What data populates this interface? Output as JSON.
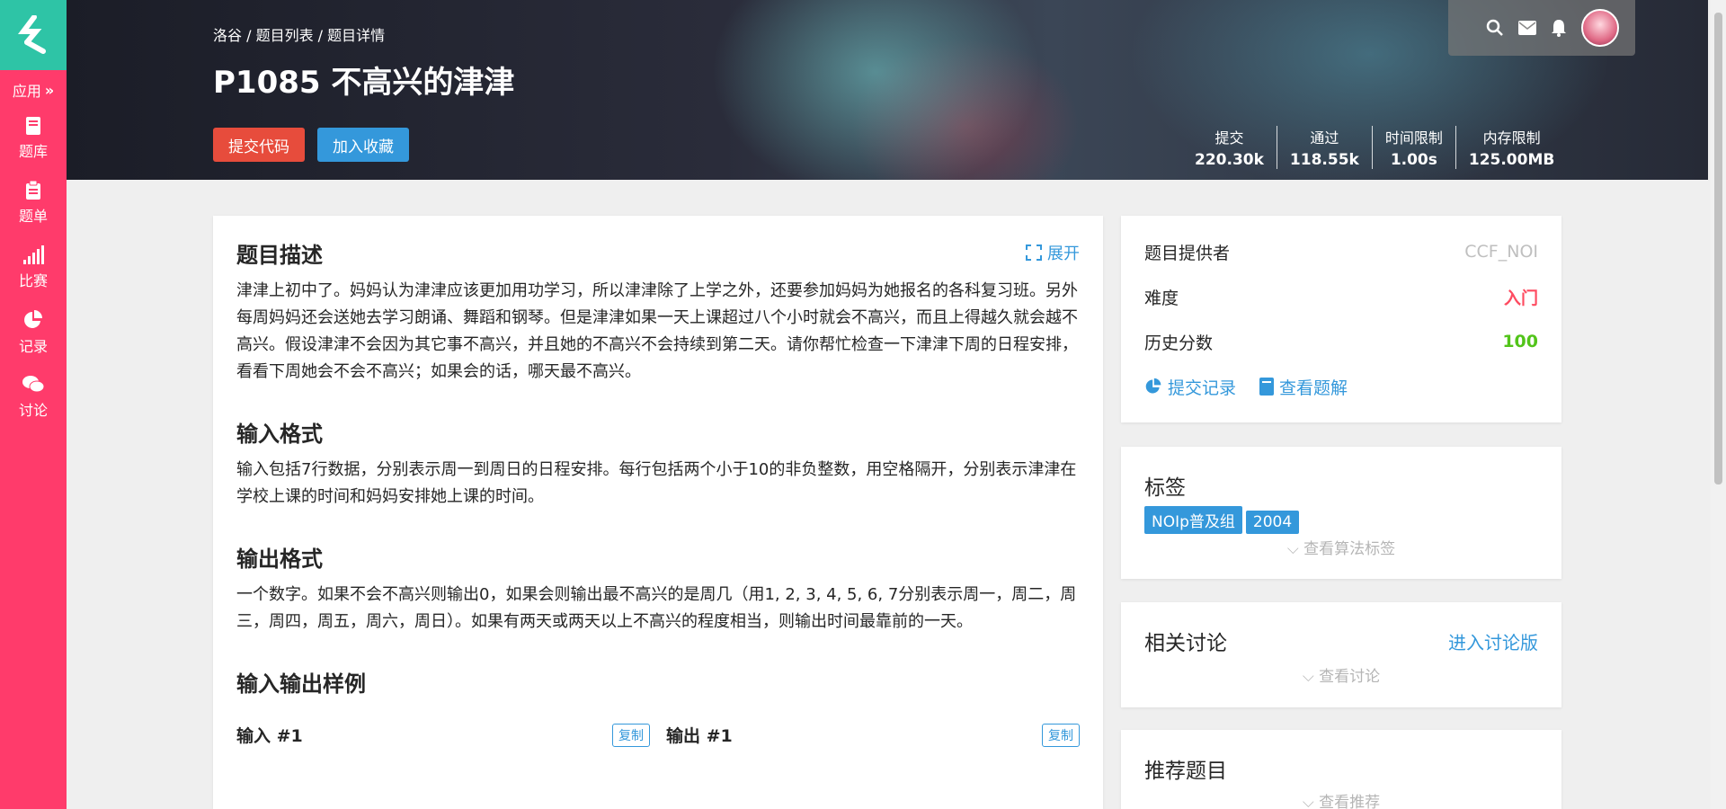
{
  "sidebar": {
    "app_label": "应用",
    "items": [
      {
        "label": "题库",
        "icon": "book-icon"
      },
      {
        "label": "题单",
        "icon": "clipboard-icon"
      },
      {
        "label": "比赛",
        "icon": "bar-chart-icon"
      },
      {
        "label": "记录",
        "icon": "pie-chart-icon"
      },
      {
        "label": "讨论",
        "icon": "chat-icon"
      }
    ]
  },
  "header": {
    "breadcrumb": "洛谷 / 题目列表 / 题目详情",
    "title": "P1085 不高兴的津津",
    "submit_label": "提交代码",
    "favorite_label": "加入收藏",
    "stats": [
      {
        "label": "提交",
        "value": "220.30k"
      },
      {
        "label": "通过",
        "value": "118.55k"
      },
      {
        "label": "时间限制",
        "value": "1.00s"
      },
      {
        "label": "内存限制",
        "value": "125.00MB"
      }
    ]
  },
  "problem": {
    "desc_title": "题目描述",
    "expand_label": "展开",
    "desc_text": "津津上初中了。妈妈认为津津应该更加用功学习，所以津津除了上学之外，还要参加妈妈为她报名的各科复习班。另外每周妈妈还会送她去学习朗诵、舞蹈和钢琴。但是津津如果一天上课超过八个小时就会不高兴，而且上得越久就会越不高兴。假设津津不会因为其它事不高兴，并且她的不高兴不会持续到第二天。请你帮忙检查一下津津下周的日程安排，看看下周她会不会不高兴；如果会的话，哪天最不高兴。",
    "input_title": "输入格式",
    "input_text": "输入包括7行数据，分别表示周一到周日的日程安排。每行包括两个小于10的非负整数，用空格隔开，分别表示津津在学校上课的时间和妈妈安排她上课的时间。",
    "output_title": "输出格式",
    "output_text": "一个数字。如果不会不高兴则输出0，如果会则输出最不高兴的是周几（用1, 2, 3, 4, 5, 6, 7分别表示周一，周二，周三，周四，周五，周六，周日）。如果有两天或两天以上不高兴的程度相当，则输出时间最靠前的一天。",
    "samples_title": "输入输出样例",
    "input_sample_label": "输入 #1",
    "output_sample_label": "输出 #1",
    "copy_label": "复制"
  },
  "info": {
    "provider_label": "题目提供者",
    "provider_value": "CCF_NOI",
    "difficulty_label": "难度",
    "difficulty_value": "入门",
    "score_label": "历史分数",
    "score_value": "100",
    "records_link": "提交记录",
    "solution_link": "查看题解",
    "provider_color": "#bfbfbf",
    "difficulty_color": "#fe4c61",
    "score_color": "#52c41a"
  },
  "tags": {
    "title": "标签",
    "items": [
      "NOIp普及组",
      "2004"
    ],
    "more": "查看算法标签"
  },
  "discussion": {
    "title": "相关讨论",
    "enter": "进入讨论版",
    "more": "查看讨论"
  },
  "recommend": {
    "title": "推荐题目",
    "more": "查看推荐"
  }
}
